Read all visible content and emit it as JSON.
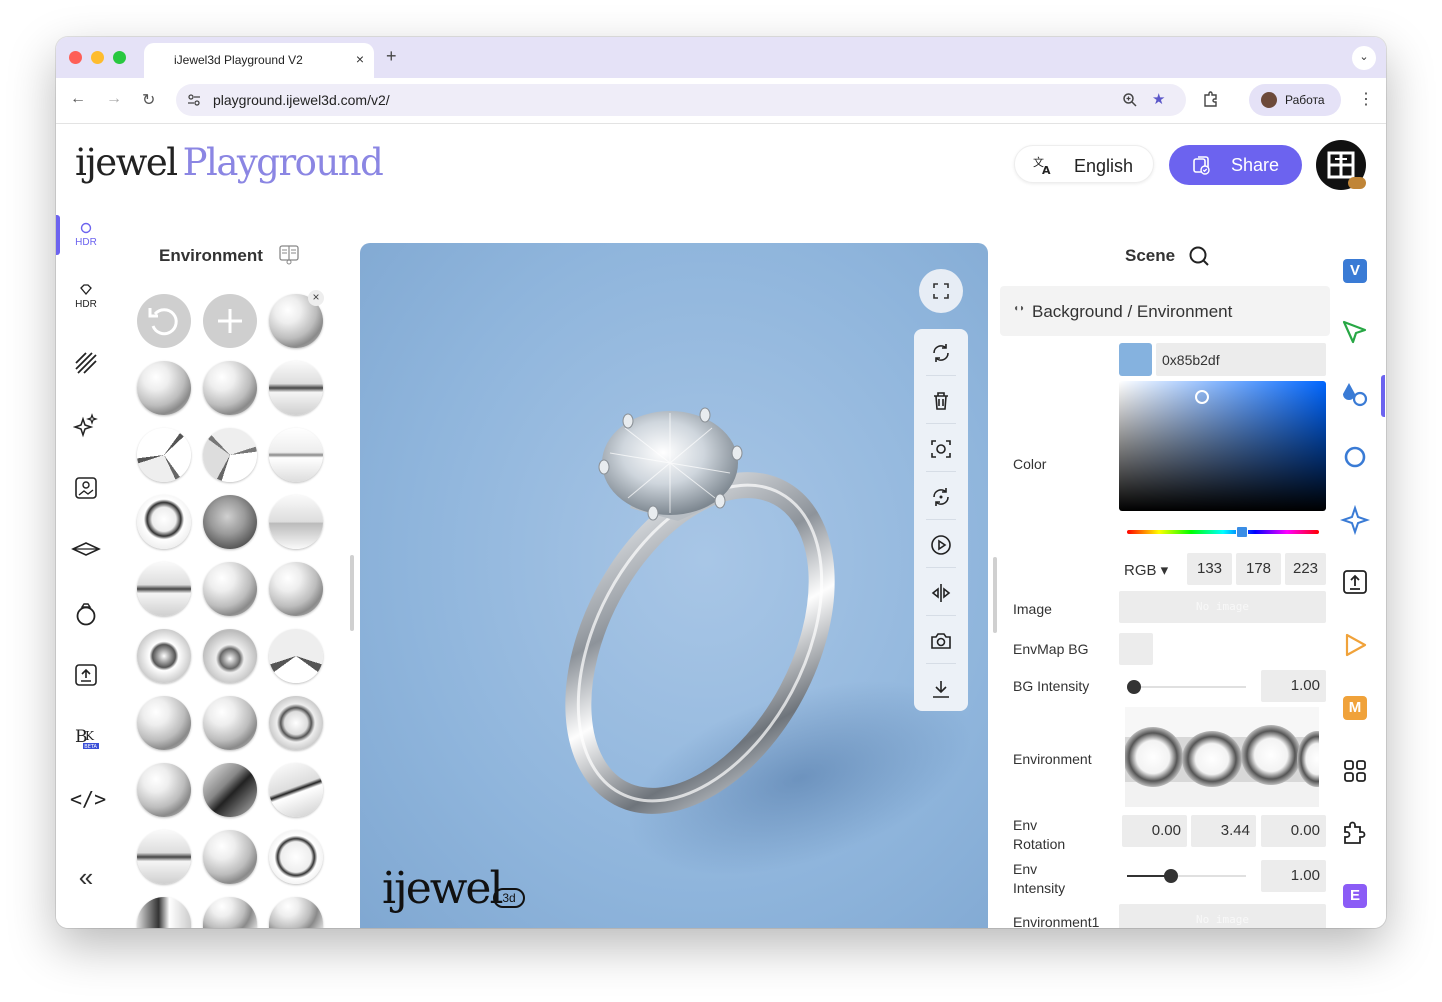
{
  "browser": {
    "tab_title": "iJewel3d Playground V2",
    "tab_close": "×",
    "new_tab": "+",
    "tab_menu": "⌄",
    "url": "playground.ijewel3d.com/v2/",
    "profile_name": "Работа"
  },
  "header": {
    "logo_part1": "ijewel",
    "logo_part2": "Playground",
    "language_label": "English",
    "share_label": "Share"
  },
  "left_rail": {
    "items": [
      {
        "icon": "hdr-sun-icon",
        "text": "HDR"
      },
      {
        "icon": "hdr-diamond-icon",
        "text": "HDR"
      },
      {
        "icon": "stripes-icon",
        "text": ""
      },
      {
        "icon": "sparkles-icon",
        "text": ""
      },
      {
        "icon": "image-icon",
        "text": ""
      },
      {
        "icon": "plane-icon",
        "text": ""
      },
      {
        "icon": "ring-icon",
        "text": ""
      },
      {
        "icon": "upload-icon",
        "text": ""
      },
      {
        "icon": "bk-icon",
        "text": "BK",
        "badge": "BETA"
      },
      {
        "icon": "code-icon",
        "text": "</>"
      }
    ],
    "collapse": "«"
  },
  "environment_panel": {
    "title": "Environment"
  },
  "viewport": {
    "background": "#85b2df",
    "brand": "ijewel",
    "brand_suffix": "3d"
  },
  "scene_panel": {
    "title": "Scene",
    "section_title": "Background / Environment",
    "section_caret": "◖◗",
    "color_label": "Color",
    "color_hex": "0x85b2df",
    "color_swatch": "#85b2df",
    "color_mode": "RGB ▾",
    "rgb": [
      "133",
      "178",
      "223"
    ],
    "hue_fraction": 0.6,
    "image_label": "Image",
    "image_value": "No image",
    "envmap_bg_label": "EnvMap BG",
    "bg_intensity_label": "BG Intensity",
    "bg_intensity_value": "1.00",
    "bg_intensity_fraction": 0.0,
    "environment_label": "Environment",
    "env_rotation_label_1": "Env",
    "env_rotation_label_2": "Rotation",
    "env_rotation": [
      "0.00",
      "3.44",
      "0.00"
    ],
    "env_intensity_label_1": "Env",
    "env_intensity_label_2": "Intensity",
    "env_intensity_value": "1.00",
    "env_intensity_fraction": 0.25,
    "environment1_label": "Environment1",
    "environment1_value": "No image"
  },
  "right_bar": {
    "items": [
      {
        "icon": "v-badge-icon",
        "text": "V",
        "color": "#3a7bd5"
      },
      {
        "icon": "cursor-icon",
        "text": ""
      },
      {
        "icon": "materials-icon",
        "text": ""
      },
      {
        "icon": "ring-outline-icon",
        "text": ""
      },
      {
        "icon": "star-icon",
        "text": ""
      },
      {
        "icon": "export-icon",
        "text": ""
      },
      {
        "icon": "play-icon",
        "text": ""
      },
      {
        "icon": "m-badge-icon",
        "text": "M",
        "color": "#f0a23a"
      },
      {
        "icon": "grid-icon",
        "text": ""
      },
      {
        "icon": "puzzle-icon",
        "text": ""
      },
      {
        "icon": "e-badge-icon",
        "text": "E",
        "color": "#8b5cf6"
      }
    ],
    "collapse": "«"
  }
}
